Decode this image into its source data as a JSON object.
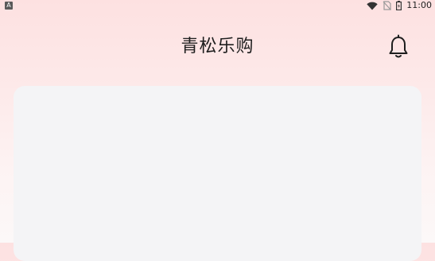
{
  "status_bar": {
    "left_badge": "A",
    "time": "11:00",
    "icons": [
      "wifi-icon",
      "no-sim-icon",
      "battery-icon"
    ]
  },
  "header": {
    "title": "青松乐购",
    "right_icon": "bell-icon"
  },
  "colors": {
    "background_top": "#fde1e1",
    "background_bottom": "#fcf8f8",
    "card": "#f4f4f6",
    "text": "#1e1e1e"
  }
}
